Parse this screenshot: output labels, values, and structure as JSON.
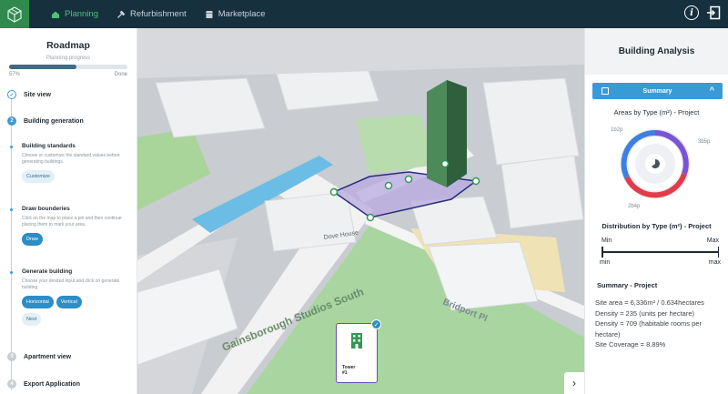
{
  "topbar": {
    "tabs": [
      {
        "label": "Planning",
        "icon": "home-icon",
        "active": true
      },
      {
        "label": "Refurbishment",
        "icon": "tools-icon",
        "active": false
      },
      {
        "label": "Marketplace",
        "icon": "store-icon",
        "active": false
      }
    ],
    "info_icon": "info-icon",
    "logout_icon": "logout-icon"
  },
  "roadmap": {
    "title": "Roadmap",
    "subtitle": "Planning progress",
    "progress_percent": 57,
    "progress_label": "57%",
    "done_label": "Done",
    "steps": [
      {
        "num": "1",
        "label": "Site view",
        "state": "done"
      },
      {
        "num": "2",
        "label": "Building generation",
        "state": "active"
      },
      {
        "num": "3",
        "label": "Apartment view",
        "state": "todo"
      },
      {
        "num": "4",
        "label": "Export Application",
        "state": "todo"
      }
    ],
    "substeps": [
      {
        "title": "Building standards",
        "desc": "Choose or customize the standard values before generating buildings.",
        "buttons": [
          "Customize"
        ]
      },
      {
        "title": "Draw bounderies",
        "desc": "Click on the map to place a pin and then continue placing them to mark your area.",
        "buttons": [
          "Draw"
        ]
      },
      {
        "title": "Generate building",
        "desc": "Choose your desired input and click on generate building",
        "buttons": [
          "Horizontal",
          "Vertical",
          "Next"
        ]
      }
    ]
  },
  "map": {
    "street_labels": [
      "Bridport Pl",
      "Gainsborough Studios South",
      "Dove House"
    ],
    "tower_card": {
      "line1": "Tower",
      "line2": "#1"
    },
    "next_icon": "chevron-right-icon"
  },
  "analysis": {
    "title": "Building Analysis",
    "summary_label": "Summary",
    "areas_heading": "Areas by Type (m²) - Project",
    "donut_labels": [
      "1b2p",
      "3b5p",
      "2b4p"
    ],
    "distribution_heading": "Distribution by Type (m²) - Project",
    "dist_min": "Min",
    "dist_max": "Max",
    "dist_min2": "min",
    "dist_max2": "max",
    "summary_heading": "Summary - Project",
    "summary_lines": [
      "Site area = 6,336m² / 0.634hectares",
      "Density = 235 (units per hectare)",
      "Density = 709 (habitable rooms per",
      "hectare)",
      "Site Coverage = 8.89%"
    ]
  },
  "colors": {
    "topbar": "#17303d",
    "accent_green": "#4ec07a",
    "accent_blue": "#3a9ad6",
    "selection_purple": "#6a4fb0"
  }
}
